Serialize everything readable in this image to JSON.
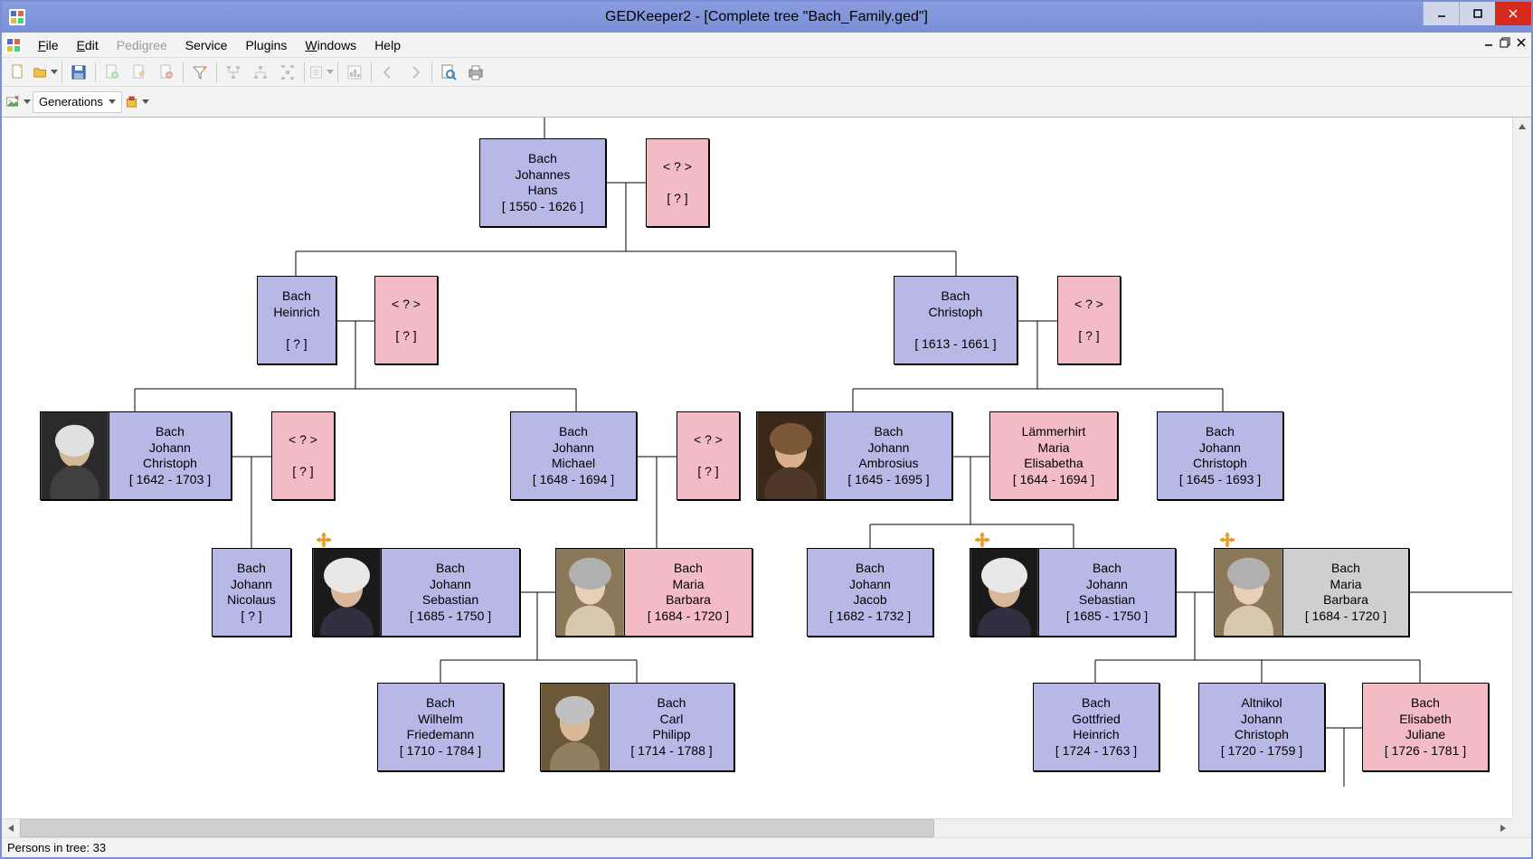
{
  "window": {
    "title": "GEDKeeper2 - [Complete tree \"Bach_Family.ged\"]"
  },
  "menu": {
    "file": "File",
    "edit": "Edit",
    "pedigree": "Pedigree",
    "service": "Service",
    "plugins": "Plugins",
    "windows": "Windows",
    "help": "Help"
  },
  "toolbar2": {
    "generations_label": "Generations"
  },
  "status": {
    "text": "Persons in tree: 33"
  },
  "nodes": {
    "johannes_hans": {
      "line1": "Bach",
      "line2": "Johannes",
      "line3": "Hans",
      "dates": "[ 1550 - 1626 ]"
    },
    "johannes_spouse": {
      "line1": "< ? >",
      "dates": "[ ? ]"
    },
    "heinrich": {
      "line1": "Bach",
      "line2": "Heinrich",
      "dates": "[ ? ]"
    },
    "heinrich_spouse": {
      "line1": "< ? >",
      "dates": "[ ? ]"
    },
    "christoph": {
      "line1": "Bach",
      "line2": "Christoph",
      "dates": "[ 1613 - 1661 ]"
    },
    "christoph_spouse": {
      "line1": "< ? >",
      "dates": "[ ? ]"
    },
    "johann_christoph_1642": {
      "line1": "Bach",
      "line2": "Johann",
      "line3": "Christoph",
      "dates": "[ 1642 - 1703 ]"
    },
    "jc1642_spouse": {
      "line1": "< ? >",
      "dates": "[ ? ]"
    },
    "johann_michael": {
      "line1": "Bach",
      "line2": "Johann",
      "line3": "Michael",
      "dates": "[ 1648 - 1694 ]"
    },
    "jm_spouse": {
      "line1": "< ? >",
      "dates": "[ ? ]"
    },
    "johann_ambrosius": {
      "line1": "Bach",
      "line2": "Johann",
      "line3": "Ambrosius",
      "dates": "[ 1645 - 1695 ]"
    },
    "laemmerhirt": {
      "line1": "Lämmerhirt",
      "line2": "Maria",
      "line3": "Elisabetha",
      "dates": "[ 1644 - 1694 ]"
    },
    "johann_christoph_1645": {
      "line1": "Bach",
      "line2": "Johann",
      "line3": "Christoph",
      "dates": "[ 1645 - 1693 ]"
    },
    "johann_nicolaus": {
      "line1": "Bach",
      "line2": "Johann",
      "line3": "Nicolaus",
      "dates": "[ ? ]"
    },
    "jsb_left": {
      "line1": "Bach",
      "line2": "Johann",
      "line3": "Sebastian",
      "dates": "[ 1685 - 1750 ]"
    },
    "mb_left": {
      "line1": "Bach",
      "line2": "Maria",
      "line3": "Barbara",
      "dates": "[ 1684 - 1720 ]"
    },
    "johann_jacob": {
      "line1": "Bach",
      "line2": "Johann",
      "line3": "Jacob",
      "dates": "[ 1682 - 1732 ]"
    },
    "jsb_right": {
      "line1": "Bach",
      "line2": "Johann",
      "line3": "Sebastian",
      "dates": "[ 1685 - 1750 ]"
    },
    "mb_right": {
      "line1": "Bach",
      "line2": "Maria",
      "line3": "Barbara",
      "dates": "[ 1684 - 1720 ]"
    },
    "wilhelm_friedemann": {
      "line1": "Bach",
      "line2": "Wilhelm",
      "line3": "Friedemann",
      "dates": "[ 1710 - 1784 ]"
    },
    "carl_philipp": {
      "line1": "Bach",
      "line2": "Carl",
      "line3": "Philipp",
      "dates": "[ 1714 - 1788 ]"
    },
    "gottfried_heinrich": {
      "line1": "Bach",
      "line2": "Gottfried",
      "line3": "Heinrich",
      "dates": "[ 1724 - 1763 ]"
    },
    "altnikol": {
      "line1": "Altnikol",
      "line2": "Johann",
      "line3": "Christoph",
      "dates": "[ 1720 - 1759 ]"
    },
    "elisabeth_juliane": {
      "line1": "Bach",
      "line2": "Elisabeth",
      "line3": "Juliane",
      "dates": "[ 1726 - 1781 ]"
    }
  }
}
